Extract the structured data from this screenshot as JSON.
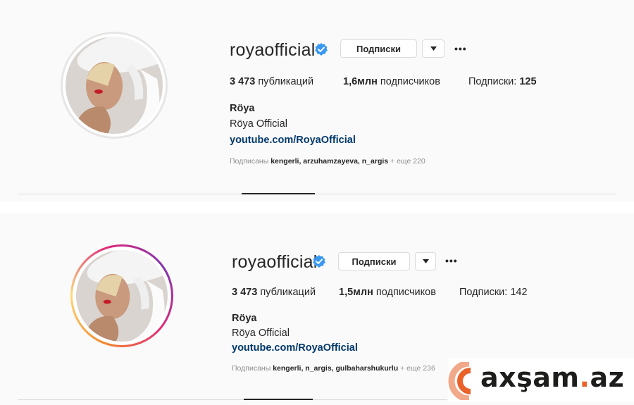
{
  "profiles": [
    {
      "username": "royaofficial",
      "follow_button": "Подписки",
      "dropdown_icon": "chevron-down-icon",
      "more_icon": "more-options-icon",
      "more_glyph": "•••",
      "stats": {
        "posts_value": "3 473",
        "posts_label": "публикаций",
        "followers_value": "1,6млн",
        "followers_label": "подписчиков",
        "following_label": "Подписки:",
        "following_value": "125"
      },
      "name": "Röya",
      "category": "Röya Official",
      "link": "youtube.com/RoyaOfficial",
      "followed_by": {
        "prefix": "Подписаны",
        "users": "kengerli, arzuhamzayeva, n_argis",
        "more": "+ еще 220"
      },
      "has_story_ring": false
    },
    {
      "username": "royaofficial",
      "follow_button": "Подписки",
      "dropdown_icon": "chevron-down-icon",
      "more_icon": "more-options-icon",
      "more_glyph": "•••",
      "stats": {
        "posts_value": "3 473",
        "posts_label": "публикаций",
        "followers_value": "1,5млн",
        "followers_label": "подписчиков",
        "following_label": "Подписки:",
        "following_value": "142"
      },
      "name": "Röya",
      "category": "Röya Official",
      "link": "youtube.com/RoyaOfficial",
      "followed_by": {
        "prefix": "Подписаны",
        "users": "kengerli, n_argis, gulbaharshukurlu",
        "more": "+ еще 236"
      },
      "has_story_ring": true
    }
  ],
  "watermark": {
    "text_main": "axşam",
    "text_dot": ".",
    "text_tld": "az",
    "accent": "#e8622a"
  },
  "colors": {
    "verified": "#3897f0",
    "link": "#00376b",
    "muted": "#8e8e8e",
    "background": "#fafafa"
  }
}
